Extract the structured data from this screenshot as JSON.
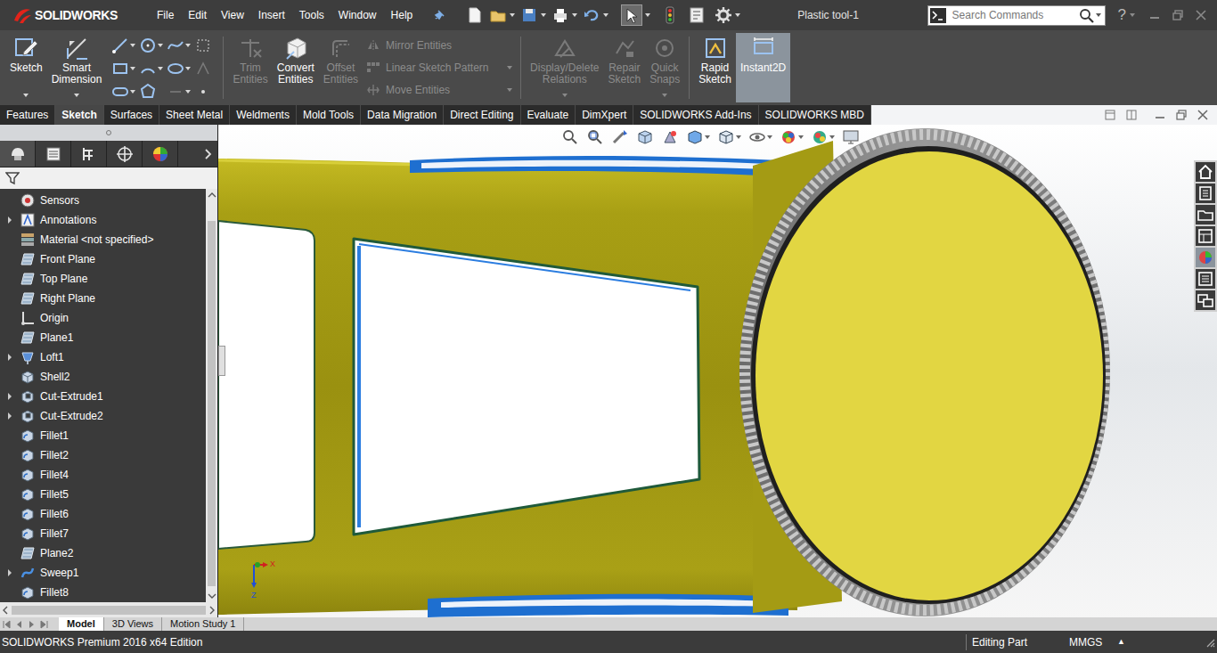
{
  "window": {
    "title": "Plastic tool-1"
  },
  "app": {
    "logo": "SOLIDWORKS"
  },
  "menu": [
    "File",
    "Edit",
    "View",
    "Insert",
    "Tools",
    "Window",
    "Help"
  ],
  "search": {
    "placeholder": "Search Commands"
  },
  "help": "?",
  "ribbon": {
    "groups": [
      {
        "items": [
          {
            "label": "Sketch",
            "kind": "large",
            "disabled": false,
            "selected": false
          },
          {
            "label": "Smart Dimension",
            "kind": "large",
            "disabled": false,
            "selected": false
          }
        ]
      },
      {
        "items": [
          {
            "label": "Trim Entities",
            "kind": "large",
            "disabled": true,
            "selected": false
          },
          {
            "label": "Convert Entities",
            "kind": "large",
            "disabled": false,
            "selected": false
          },
          {
            "label": "Offset Entities",
            "kind": "large",
            "disabled": true,
            "selected": false
          },
          {
            "label": "Mirror Entities",
            "kind": "small",
            "disabled": true,
            "selected": false
          },
          {
            "label": "Linear Sketch Pattern",
            "kind": "small",
            "disabled": true,
            "selected": false
          },
          {
            "label": "Move Entities",
            "kind": "small",
            "disabled": true,
            "selected": false
          }
        ]
      },
      {
        "items": [
          {
            "label": "Display/Delete Relations",
            "kind": "large",
            "disabled": true,
            "selected": false
          },
          {
            "label": "Repair Sketch",
            "kind": "large",
            "disabled": true,
            "selected": false
          },
          {
            "label": "Quick Snaps",
            "kind": "large",
            "disabled": true,
            "selected": false
          }
        ]
      },
      {
        "items": [
          {
            "label": "Rapid Sketch",
            "kind": "large",
            "disabled": false,
            "selected": false
          },
          {
            "label": "Instant2D",
            "kind": "large",
            "disabled": false,
            "selected": true
          }
        ]
      }
    ]
  },
  "tabs": [
    {
      "label": "Features",
      "selected": false
    },
    {
      "label": "Sketch",
      "selected": true
    },
    {
      "label": "Surfaces",
      "selected": false
    },
    {
      "label": "Sheet Metal",
      "selected": false
    },
    {
      "label": "Weldments",
      "selected": false
    },
    {
      "label": "Mold Tools",
      "selected": false
    },
    {
      "label": "Data Migration",
      "selected": false
    },
    {
      "label": "Direct Editing",
      "selected": false
    },
    {
      "label": "Evaluate",
      "selected": false
    },
    {
      "label": "DimXpert",
      "selected": false
    },
    {
      "label": "SOLIDWORKS Add-Ins",
      "selected": false
    },
    {
      "label": "SOLIDWORKS MBD",
      "selected": false
    }
  ],
  "tree": {
    "items": [
      {
        "label": "Sensors",
        "kind": "sensor",
        "expandable": false
      },
      {
        "label": "Annotations",
        "kind": "annotation",
        "expandable": true
      },
      {
        "label": "Material <not specified>",
        "kind": "material",
        "expandable": false
      },
      {
        "label": "Front Plane",
        "kind": "plane",
        "expandable": false
      },
      {
        "label": "Top Plane",
        "kind": "plane",
        "expandable": false
      },
      {
        "label": "Right Plane",
        "kind": "plane",
        "expandable": false
      },
      {
        "label": "Origin",
        "kind": "origin",
        "expandable": false
      },
      {
        "label": "Plane1",
        "kind": "plane",
        "expandable": false
      },
      {
        "label": "Loft1",
        "kind": "loft",
        "expandable": true
      },
      {
        "label": "Shell2",
        "kind": "shell",
        "expandable": false
      },
      {
        "label": "Cut-Extrude1",
        "kind": "cut",
        "expandable": true
      },
      {
        "label": "Cut-Extrude2",
        "kind": "cut",
        "expandable": true
      },
      {
        "label": "Fillet1",
        "kind": "fillet",
        "expandable": false
      },
      {
        "label": "Fillet2",
        "kind": "fillet",
        "expandable": false
      },
      {
        "label": "Fillet4",
        "kind": "fillet",
        "expandable": false
      },
      {
        "label": "Fillet5",
        "kind": "fillet",
        "expandable": false
      },
      {
        "label": "Fillet6",
        "kind": "fillet",
        "expandable": false
      },
      {
        "label": "Fillet7",
        "kind": "fillet",
        "expandable": false
      },
      {
        "label": "Plane2",
        "kind": "plane",
        "expandable": false
      },
      {
        "label": "Sweep1",
        "kind": "sweep",
        "expandable": true
      },
      {
        "label": "Fillet8",
        "kind": "fillet",
        "expandable": false
      }
    ]
  },
  "triad": {
    "x": "X",
    "z": "Z"
  },
  "bottom_tabs": [
    {
      "label": "Model",
      "selected": true
    },
    {
      "label": "3D Views",
      "selected": false
    },
    {
      "label": "Motion Study 1",
      "selected": false
    }
  ],
  "status_bar": {
    "edition": "SOLIDWORKS Premium 2016 x64 Edition",
    "mode": "Editing Part",
    "units": "MMGS",
    "units_arrow": "▲"
  }
}
